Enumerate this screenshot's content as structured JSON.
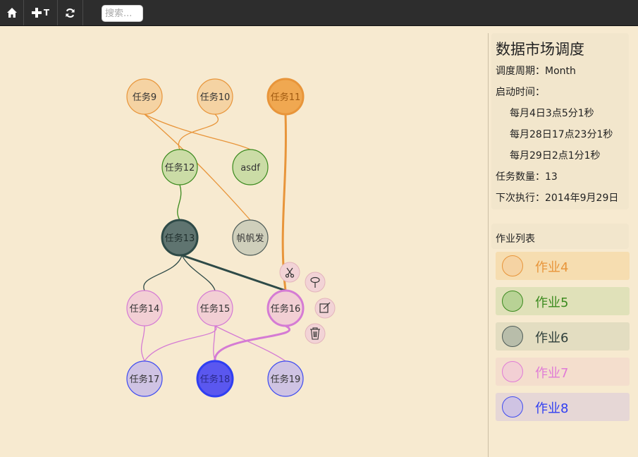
{
  "toolbar": {
    "home_icon": "home-icon",
    "add_icon": "plus-icon",
    "add_label": "T",
    "refresh_icon": "refresh-icon",
    "search_placeholder": "搜索..."
  },
  "graph": {
    "nodes": {
      "t9": "任务9",
      "t10": "任务10",
      "t11": "任务11",
      "t12": "任务12",
      "asdf": "asdf",
      "t13": "任务13",
      "fanfan": "帆帆发",
      "t14": "任务14",
      "t15": "任务15",
      "t16": "任务16",
      "t17": "任务17",
      "t18": "任务18",
      "t19": "任务19"
    },
    "context_tools": [
      "scissors-icon",
      "pin-icon",
      "edit-icon",
      "trash-icon"
    ]
  },
  "info": {
    "title": "数据市场调度",
    "period": "调度周期：Month",
    "start_label": "启动时间：",
    "start_times": [
      "每月4日3点5分1秒",
      "每月28日17点23分1秒",
      "每月29日2点1分1秒"
    ],
    "task_count": "任务数量：13",
    "next_run": "下次执行：2014年9月29日"
  },
  "job_list": {
    "header": "作业列表",
    "jobs": [
      {
        "label": "作业4",
        "color": "#e8953a"
      },
      {
        "label": "作业5",
        "color": "#3b8a1e"
      },
      {
        "label": "作业6",
        "color": "#2e3e3a"
      },
      {
        "label": "作业7",
        "color": "#e07bd6"
      },
      {
        "label": "作业8",
        "color": "#2f3ef2"
      }
    ]
  },
  "colors": {
    "orange": "#e8953a",
    "green": "#3b8a1e",
    "slate": "#2e4a47",
    "pink": "#d57bd4",
    "blue": "#3f4cf0"
  }
}
